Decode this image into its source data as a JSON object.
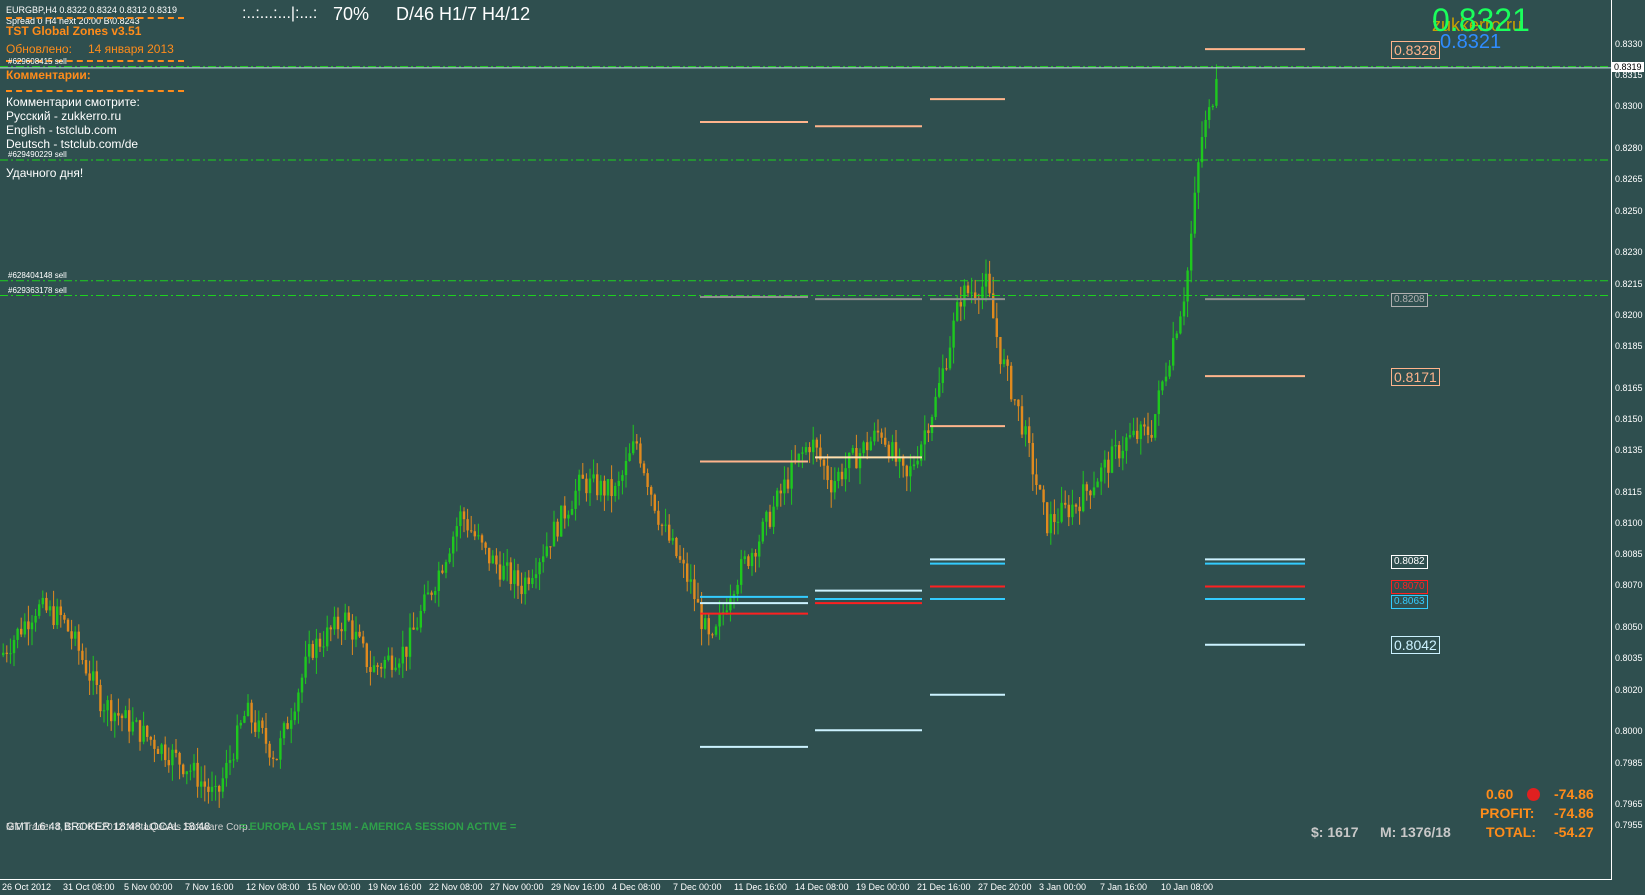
{
  "header": {
    "symbol_line": "EURGBP,H4  0.8322 0.8324 0.8312 0.8319",
    "spread_line": "Spread 0  H4 next 20:00 B\\0.8243",
    "indicator_title": "TST Global Zones  v3.51",
    "updated_label": "Обновлено:",
    "updated_date": "14 января 2013",
    "comments_title": "Комментарии:",
    "comments_intro": "Комментарии смотрите:",
    "links": [
      "Русский  - zukkerro.ru",
      "English - tstclub.com",
      "Deutsch - tstclub.com/de"
    ],
    "farewell": "Удачного дня!",
    "progress_dots": ":..:...:...|:...:",
    "progress_pct": "70%",
    "timeframes": "D/46  H1/7  H4/12"
  },
  "price_display": {
    "big_price": "0.8321",
    "small_price": "0.8321",
    "watermark": "zukkerro.ru"
  },
  "orders": [
    {
      "label": "#629608415 sell",
      "price": 0.83196
    },
    {
      "label": "#629490229 sell",
      "price": 0.82748
    },
    {
      "label": "#628404148 sell",
      "price": 0.82168
    },
    {
      "label": "#629363178 sell",
      "price": 0.82097
    }
  ],
  "bid_line": 0.8319,
  "price_axis": {
    "current": "0.8319",
    "ticks": [
      "0.8330",
      "0.8315",
      "0.8300",
      "0.8280",
      "0.8265",
      "0.8250",
      "0.8230",
      "0.8215",
      "0.8200",
      "0.8185",
      "0.8165",
      "0.8150",
      "0.8135",
      "0.8115",
      "0.8100",
      "0.8085",
      "0.8070",
      "0.8050",
      "0.8035",
      "0.8020",
      "0.8000",
      "0.7985",
      "0.7965",
      "0.7955"
    ]
  },
  "time_axis": [
    "26 Oct 2012",
    "31 Oct 08:00",
    "5 Nov 00:00",
    "7 Nov 16:00",
    "12 Nov 08:00",
    "15 Nov 00:00",
    "19 Nov 16:00",
    "22 Nov 08:00",
    "27 Nov 00:00",
    "29 Nov 16:00",
    "4 Dec 08:00",
    "7 Dec 00:00",
    "11 Dec 16:00",
    "14 Dec 08:00",
    "19 Dec 00:00",
    "21 Dec 16:00",
    "27 Dec 20:00",
    "3 Jan 00:00",
    "7 Jan 16:00",
    "10 Jan 08:00"
  ],
  "level_labels": [
    {
      "text": "0.8328",
      "price": 0.8328,
      "color": "#ffb48c",
      "size": "big"
    },
    {
      "text": "0.8208",
      "price": 0.8208,
      "color": "#b0b0b0",
      "size": "small"
    },
    {
      "text": "0.8171",
      "price": 0.8171,
      "color": "#ffb48c",
      "size": "big"
    },
    {
      "text": "0.8082",
      "price": 0.8082,
      "color": "#ffffff",
      "size": "small"
    },
    {
      "text": "0.8070",
      "price": 0.807,
      "color": "#ff2020",
      "size": "small"
    },
    {
      "text": "0.8063",
      "price": 0.8063,
      "color": "#33ccff",
      "size": "small"
    },
    {
      "text": "0.8042",
      "price": 0.8042,
      "color": "#ccf2ff",
      "size": "big"
    }
  ],
  "footer": {
    "gmt_line": "GMT 16:48  BROKER 18:48  LOCAL 18:48",
    "copyright": "MT Trader 4, © 2001-2012 MetaQuotes Software Corp.",
    "session": "= EUROPA LAST 15M - AMERICA SESSION ACTIVE =",
    "lots": "0.60",
    "lots_pl": "-74.86",
    "profit_label": "PROFIT:",
    "profit_value": "-74.86",
    "balance_label": "$: 1617",
    "margin_label": "M: 1376/18",
    "total_label": "TOTAL:",
    "total_value": "-54.27"
  },
  "colors": {
    "background": "#2f4f4f",
    "bull": "#1ec81e",
    "bear": "#e08a1e",
    "grid_dash": "#1ed21e",
    "accent_orange": "#ff8c1a",
    "resistance": "#ffb48c",
    "support": "#ccf2ff",
    "red_level": "#ff2020",
    "blue_level": "#33ccff"
  }
}
